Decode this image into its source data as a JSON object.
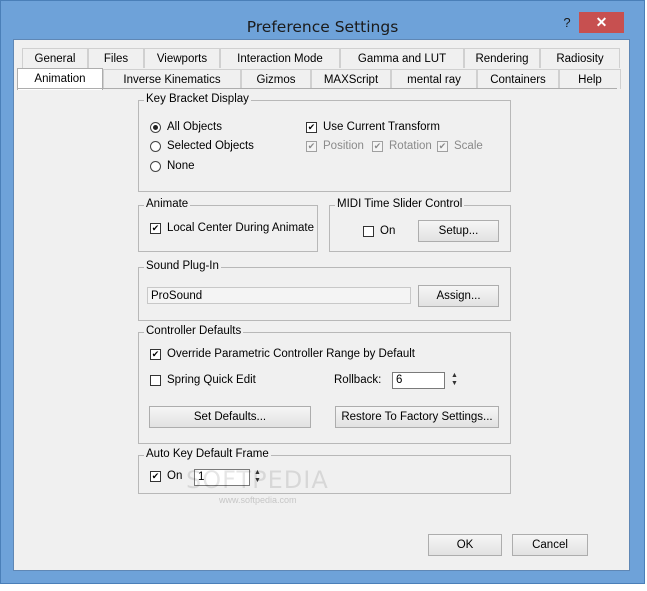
{
  "window": {
    "title": "Preference Settings",
    "help_label": "?",
    "close_label": "✕"
  },
  "tabs": {
    "row1": [
      "General",
      "Files",
      "Viewports",
      "Interaction Mode",
      "Gamma and LUT",
      "Rendering",
      "Radiosity"
    ],
    "row2": [
      "Animation",
      "Inverse Kinematics",
      "Gizmos",
      "MAXScript",
      "mental ray",
      "Containers",
      "Help"
    ],
    "active": "Animation"
  },
  "key_bracket": {
    "title": "Key Bracket Display",
    "options": [
      "All Objects",
      "Selected Objects",
      "None"
    ],
    "selected": "All Objects",
    "use_current_transform": "Use Current Transform",
    "use_current_transform_checked": true,
    "position": "Position",
    "rotation": "Rotation",
    "scale": "Scale"
  },
  "animate": {
    "title": "Animate",
    "local_center": "Local Center During Animate",
    "local_center_checked": true
  },
  "midi": {
    "title": "MIDI Time Slider Control",
    "on_label": "On",
    "on_checked": false,
    "setup_label": "Setup..."
  },
  "sound": {
    "title": "Sound Plug-In",
    "value": "ProSound",
    "assign_label": "Assign..."
  },
  "controller": {
    "title": "Controller Defaults",
    "override": "Override Parametric Controller Range by Default",
    "override_checked": true,
    "spring": "Spring Quick Edit",
    "spring_checked": false,
    "rollback_label": "Rollback:",
    "rollback_value": "6",
    "set_defaults_label": "Set Defaults...",
    "restore_label": "Restore To Factory Settings..."
  },
  "autokey": {
    "title": "Auto Key Default Frame",
    "on_label": "On",
    "on_checked": true,
    "frame_value": "1"
  },
  "footer": {
    "ok_label": "OK",
    "cancel_label": "Cancel"
  },
  "watermark": {
    "main": "SOFTPEDIA",
    "sub": "www.softpedia.com"
  }
}
